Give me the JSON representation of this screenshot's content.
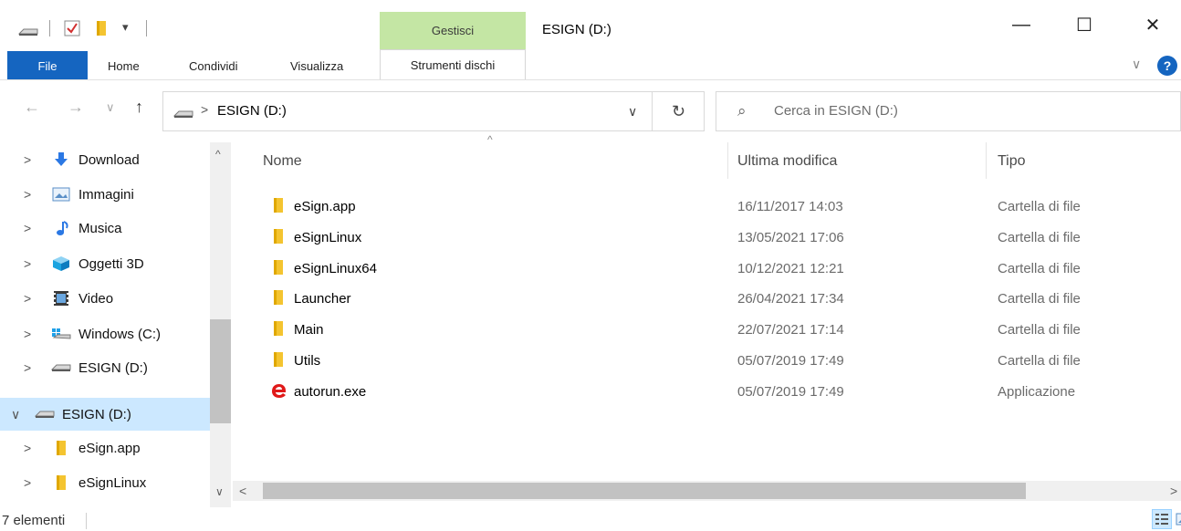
{
  "titlebar": {
    "title": "ESIGN (D:)",
    "contextual_tab_group": "Gestisci",
    "minimize_glyph": "—",
    "maximize_glyph": "☐",
    "close_glyph": "✕",
    "qat_dropdown_glyph": "▾"
  },
  "ribbon": {
    "tabs": [
      "File",
      "Home",
      "Condividi",
      "Visualizza",
      "Strumenti dischi"
    ],
    "help_glyph": "?",
    "collapse_glyph": "∨",
    "accent_color": "#1565c0",
    "contextual_color": "#c4e6a4"
  },
  "navbar": {
    "back_glyph": "←",
    "forward_glyph": "→",
    "recent_glyph": "∨",
    "up_glyph": "↑",
    "breadcrumb_separator": ">",
    "address": "ESIGN (D:)",
    "address_dropdown_glyph": "∨",
    "refresh_glyph": "↻",
    "search_glyph": "⌕",
    "search_placeholder": "Cerca in ESIGN (D:)"
  },
  "navpane": {
    "items": [
      {
        "label": "Download",
        "icon": "download-icon",
        "chevron": ">"
      },
      {
        "label": "Immagini",
        "icon": "pictures-icon",
        "chevron": ">"
      },
      {
        "label": "Musica",
        "icon": "music-icon",
        "chevron": ">"
      },
      {
        "label": "Oggetti 3D",
        "icon": "3d-objects-icon",
        "chevron": ">"
      },
      {
        "label": "Video",
        "icon": "video-icon",
        "chevron": ">"
      },
      {
        "label": "Windows  (C:)",
        "icon": "windows-drive-icon",
        "chevron": ">"
      },
      {
        "label": "ESIGN (D:)",
        "icon": "drive-icon",
        "chevron": ">"
      },
      {
        "label": "ESIGN (D:)",
        "icon": "drive-icon",
        "chevron": "∨",
        "selected": true
      },
      {
        "label": "eSign.app",
        "icon": "folder-icon",
        "chevron": ">"
      },
      {
        "label": "eSignLinux",
        "icon": "folder-icon",
        "chevron": ">"
      }
    ],
    "scroll_up_glyph": "^",
    "scroll_down_glyph": "∨"
  },
  "filelist": {
    "columns": {
      "name": "Nome",
      "modified": "Ultima modifica",
      "type": "Tipo"
    },
    "sort_glyph": "^",
    "rows": [
      {
        "name": "eSign.app",
        "modified": "16/11/2017 14:03",
        "type": "Cartella di file",
        "icon": "folder-icon"
      },
      {
        "name": "eSignLinux",
        "modified": "13/05/2021 17:06",
        "type": "Cartella di file",
        "icon": "folder-icon"
      },
      {
        "name": "eSignLinux64",
        "modified": "10/12/2021 12:21",
        "type": "Cartella di file",
        "icon": "folder-icon"
      },
      {
        "name": "Launcher",
        "modified": "26/04/2021 17:34",
        "type": "Cartella di file",
        "icon": "folder-icon"
      },
      {
        "name": "Main",
        "modified": "22/07/2021 17:14",
        "type": "Cartella di file",
        "icon": "folder-icon"
      },
      {
        "name": "Utils",
        "modified": "05/07/2019 17:49",
        "type": "Cartella di file",
        "icon": "folder-icon"
      },
      {
        "name": "autorun.exe",
        "modified": "05/07/2019 17:49",
        "type": "Applicazione",
        "icon": "esign-app-icon"
      }
    ],
    "hscroll_left_glyph": "<",
    "hscroll_right_glyph": ">"
  },
  "statusbar": {
    "count": "7 elementi"
  }
}
